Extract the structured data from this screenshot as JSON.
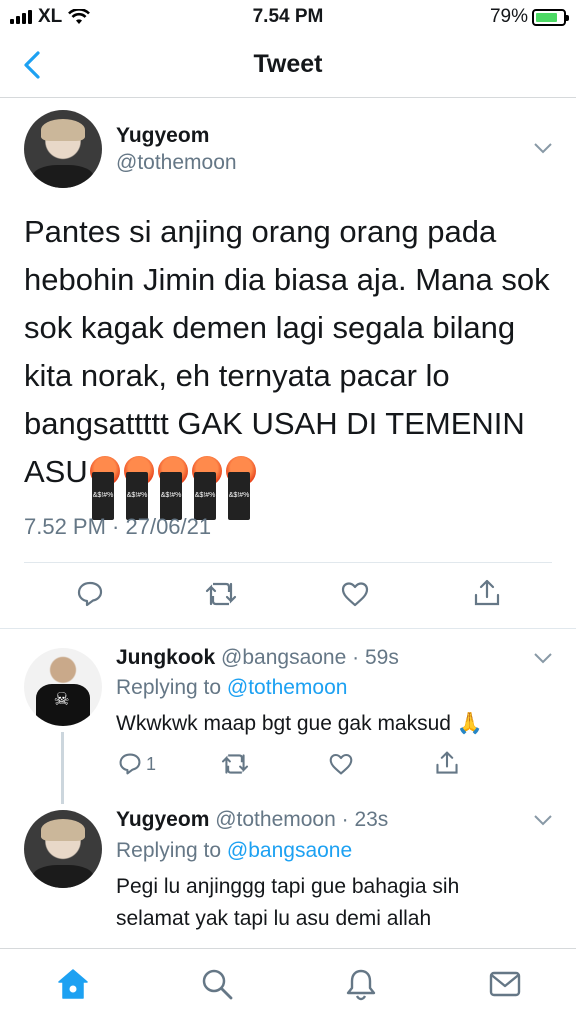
{
  "status": {
    "carrier": "XL",
    "time": "7.54 PM",
    "battery": "79%"
  },
  "nav": {
    "title": "Tweet"
  },
  "tweet": {
    "name": "Yugyeom",
    "handle": "@tothemoon",
    "text": "Pantes si anjing orang orang pada hebohin Jimin dia biasa aja. Mana sok sok kagak demen lagi segala bilang kita norak, eh ternyata pacar lo bangsattttt GAK USAH DI TEMENIN ASU",
    "emoji_count": 5,
    "timestamp": "7.52 PM · 27/06/21"
  },
  "replies": [
    {
      "name": "Jungkook",
      "handle": "@bangsaone",
      "age": "· 59s",
      "replying_label": "Replying to ",
      "replying_to": "@tothemoon",
      "text": "Wkwkwk maap bgt gue gak maksud 🙏",
      "reply_count": "1"
    },
    {
      "name": "Yugyeom",
      "handle": "@tothemoon",
      "age": "· 23s",
      "replying_label": "Replying to ",
      "replying_to": "@bangsaone",
      "text_line1": "Pegi lu anjinggg tapi gue bahagia sih",
      "text_line2": "selamat yak tapi lu asu demi allah"
    }
  ],
  "colors": {
    "accent": "#1da1f2",
    "muted": "#657786",
    "text": "#14171a",
    "battery_fill": "#4cd964"
  },
  "icons": [
    "back-chevron-icon",
    "reply-icon",
    "retweet-icon",
    "like-icon",
    "share-icon",
    "home-icon",
    "search-icon",
    "notifications-icon",
    "messages-icon"
  ]
}
